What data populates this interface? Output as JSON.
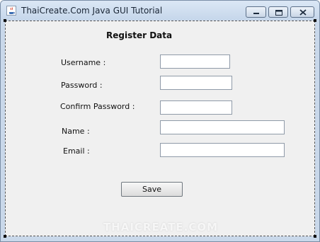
{
  "window": {
    "title": "ThaiCreate.Com Java GUI Tutorial"
  },
  "titlebar_icons": {
    "app": "java-coffee-icon",
    "minimize": "minimize-icon",
    "maximize": "maximize-icon",
    "close": "close-icon"
  },
  "form": {
    "title": "Register Data",
    "username_label": "Username :",
    "password_label": "Password :",
    "confirm_password_label": "Confirm Password :",
    "name_label": "Name :",
    "email_label": "Email :",
    "username_value": "",
    "password_value": "",
    "confirm_password_value": "",
    "name_value": "",
    "email_value": "",
    "save_label": "Save"
  },
  "watermark": "THAICREATE.COM"
}
